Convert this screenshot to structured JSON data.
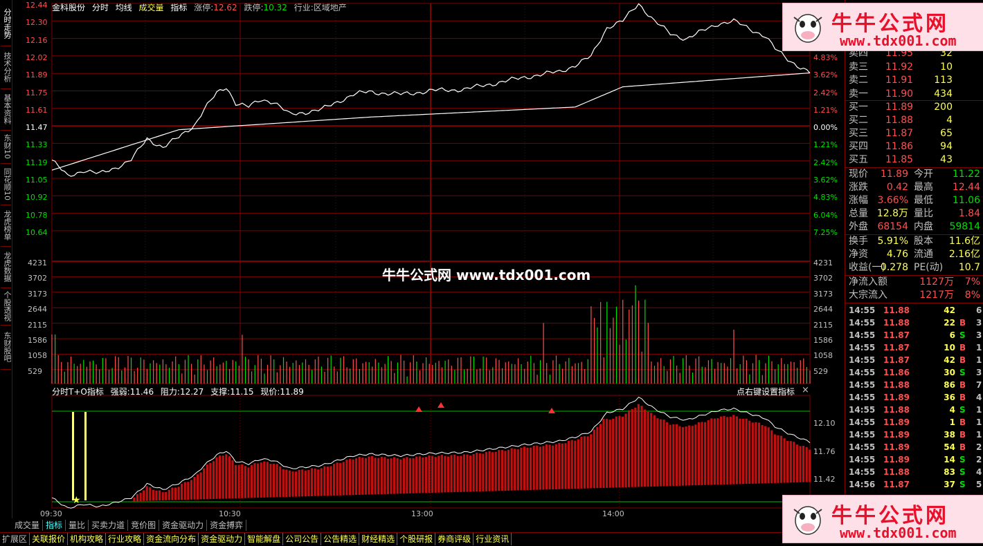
{
  "header": {
    "stock_name": "金科股份",
    "items": [
      "分时",
      "均线",
      "成交量",
      "指标"
    ],
    "limit_up_label": "涨停:",
    "limit_up_value": "12.62",
    "limit_down_label": "跌停:",
    "limit_down_value": "10.32",
    "industry": "行业:区域地产"
  },
  "left_tabs": [
    "分时走势",
    "技术分析",
    "基本资料",
    "东财10",
    "同花顺10",
    "龙虎榜单",
    "龙虎数据",
    "个股透视",
    "东财股吧"
  ],
  "price_axis_left": [
    "12.44",
    "12.30",
    "12.16",
    "12.02",
    "11.89",
    "11.75",
    "11.61",
    "11.47",
    "11.33",
    "11.19",
    "11.05",
    "10.92",
    "10.78",
    "10.64"
  ],
  "price_axis_right": [
    "5.84%",
    "4.83%",
    "3.62%",
    "2.42%",
    "1.21%",
    "0.00%",
    "1.21%",
    "2.42%",
    "3.62%",
    "4.83%",
    "6.04%",
    "7.25%"
  ],
  "volume_axis": [
    "4231",
    "3702",
    "3173",
    "2644",
    "2115",
    "1586",
    "1058",
    "529"
  ],
  "watermark": "牛牛公式网 www.tdx001.com",
  "indicator": {
    "title": "分时T+O指标",
    "strength_label": "强弱:",
    "strength_value": "11.46",
    "resistance_label": "阻力:",
    "resistance_value": "12.27",
    "support_label": "支撑:",
    "support_value": "11.15",
    "price_label": "现价:",
    "price_value": "11.89",
    "right_hint": "点右键设置指标",
    "close": "×",
    "axis": [
      "12.10",
      "11.76",
      "11.42"
    ]
  },
  "time_axis": [
    "09:30",
    "10:30",
    "13:00",
    "14:00"
  ],
  "bottom_tabs": [
    "成交量",
    "指标",
    "量比",
    "买卖力道",
    "竞价图",
    "资金驱动力",
    "资金搏弈"
  ],
  "bottom_tabs2": [
    "扩展区",
    "关联报价",
    "机构攻略",
    "行业攻略",
    "资金流向分布",
    "资金驱动力",
    "智能解盘",
    "公司公告",
    "公告精选",
    "财经精选",
    "个股研报",
    "券商评级",
    "行业资讯"
  ],
  "order_book": {
    "sells": [
      {
        "label": "卖四",
        "price": "11.95",
        "vol": "32"
      },
      {
        "label": "卖三",
        "price": "11.92",
        "vol": "10"
      },
      {
        "label": "卖二",
        "price": "11.91",
        "vol": "113"
      },
      {
        "label": "卖一",
        "price": "11.90",
        "vol": "434"
      }
    ],
    "buys": [
      {
        "label": "买一",
        "price": "11.89",
        "vol": "200"
      },
      {
        "label": "买二",
        "price": "11.88",
        "vol": "4"
      },
      {
        "label": "买三",
        "price": "11.87",
        "vol": "65"
      },
      {
        "label": "买四",
        "price": "11.86",
        "vol": "94"
      },
      {
        "label": "买五",
        "price": "11.85",
        "vol": "43"
      }
    ]
  },
  "quote": [
    {
      "l1": "现价",
      "v1": "11.89",
      "l2": "今开",
      "v2": "11.22",
      "c1": "red",
      "c2": "green"
    },
    {
      "l1": "涨跌",
      "v1": "0.42",
      "l2": "最高",
      "v2": "12.44",
      "c1": "red",
      "c2": "red"
    },
    {
      "l1": "涨幅",
      "v1": "3.66%",
      "l2": "最低",
      "v2": "11.06",
      "c1": "red",
      "c2": "green"
    },
    {
      "l1": "总量",
      "v1": "12.8万",
      "l2": "量比",
      "v2": "1.84",
      "c1": "yellow",
      "c2": "red"
    },
    {
      "l1": "外盘",
      "v1": "68154",
      "l2": "内盘",
      "v2": "59814",
      "c1": "red",
      "c2": "green"
    },
    {
      "l1": "换手",
      "v1": "5.91%",
      "l2": "股本",
      "v2": "11.6亿",
      "c1": "yellow",
      "c2": "yellow"
    },
    {
      "l1": "净资",
      "v1": "4.76",
      "l2": "流通",
      "v2": "2.16亿",
      "c1": "yellow",
      "c2": "yellow"
    },
    {
      "l1": "收益(一)",
      "v1": "0.278",
      "l2": "PE(动)",
      "v2": "10.7",
      "c1": "yellow",
      "c2": "yellow"
    }
  ],
  "flow": [
    {
      "label": "净流入额",
      "value": "1127万",
      "pct": "7%"
    },
    {
      "label": "大宗流入",
      "value": "1217万",
      "pct": "8%"
    }
  ],
  "ticks": [
    {
      "t": "14:55",
      "p": "11.88",
      "v": "42",
      "d": "",
      "n": "6"
    },
    {
      "t": "14:55",
      "p": "11.88",
      "v": "22",
      "d": "B",
      "n": "3"
    },
    {
      "t": "14:55",
      "p": "11.87",
      "v": "6",
      "d": "S",
      "n": "3"
    },
    {
      "t": "14:55",
      "p": "11.87",
      "v": "10",
      "d": "B",
      "n": "1"
    },
    {
      "t": "14:55",
      "p": "11.87",
      "v": "42",
      "d": "B",
      "n": "1"
    },
    {
      "t": "14:55",
      "p": "11.86",
      "v": "30",
      "d": "S",
      "n": "3"
    },
    {
      "t": "14:55",
      "p": "11.88",
      "v": "86",
      "d": "B",
      "n": "7"
    },
    {
      "t": "14:55",
      "p": "11.89",
      "v": "36",
      "d": "B",
      "n": "4"
    },
    {
      "t": "14:55",
      "p": "11.88",
      "v": "4",
      "d": "S",
      "n": "1"
    },
    {
      "t": "14:55",
      "p": "11.89",
      "v": "1",
      "d": "B",
      "n": "1"
    },
    {
      "t": "14:55",
      "p": "11.89",
      "v": "38",
      "d": "B",
      "n": "1"
    },
    {
      "t": "14:55",
      "p": "11.89",
      "v": "54",
      "d": "B",
      "n": "2"
    },
    {
      "t": "14:55",
      "p": "11.89",
      "v": "14",
      "d": "S",
      "n": "2"
    },
    {
      "t": "14:55",
      "p": "11.88",
      "v": "83",
      "d": "S",
      "n": "4"
    },
    {
      "t": "14:56",
      "p": "11.87",
      "v": "37",
      "d": "S",
      "n": "5"
    }
  ],
  "logo": {
    "title": "牛牛公式网",
    "url": "www.tdx001.com"
  },
  "colors": {
    "up": "#ff5050",
    "down": "#00e000",
    "grid": "#800000",
    "price_line": "#ffffff",
    "avg_line": "#ffff54",
    "bar_red": "#c01010"
  }
}
